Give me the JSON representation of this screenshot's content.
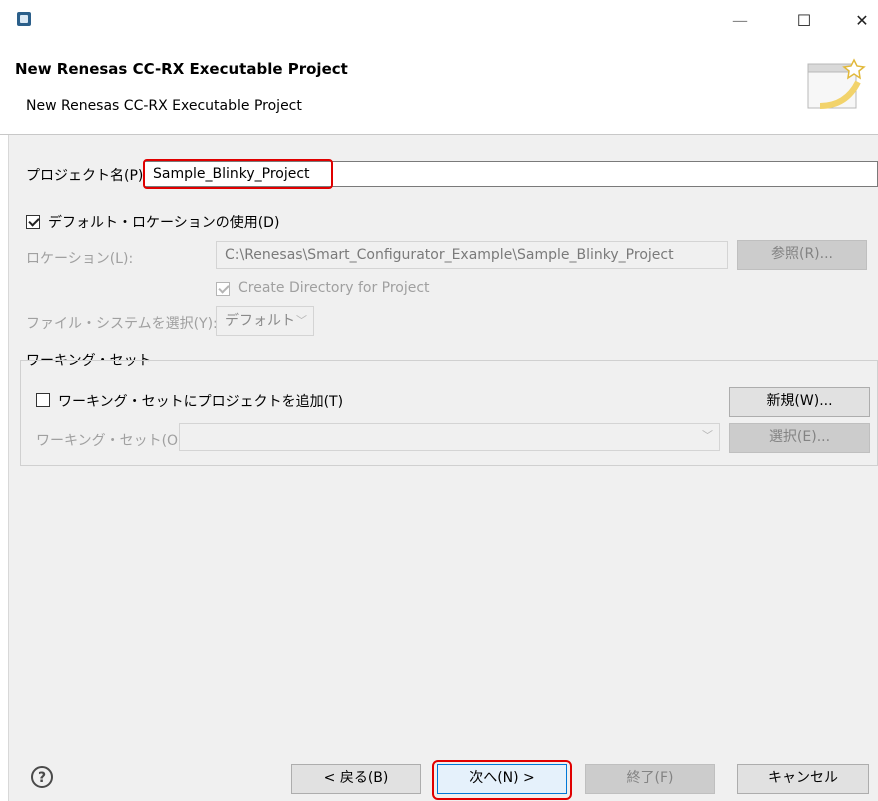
{
  "window": {
    "title_icon": "eclipse-app-icon",
    "controls": {
      "minimize": "—",
      "maximize": "☐",
      "close": "✕"
    }
  },
  "header": {
    "title": "New Renesas CC-RX Executable Project",
    "description": "New Renesas CC-RX Executable Project",
    "wizard_icon": "wizard-banner-icon"
  },
  "form": {
    "project_name_label": "プロジェクト名(P):",
    "project_name_value": "Sample_Blinky_Project",
    "use_default_location_label": "デフォルト・ロケーションの使用(D)",
    "use_default_location_checked": true,
    "location_label": "ロケーション(L):",
    "location_value": "C:\\Renesas\\Smart_Configurator_Example\\Sample_Blinky_Project",
    "browse_label": "参照(R)...",
    "create_directory_label": "Create Directory for Project",
    "create_directory_checked": true,
    "file_system_label": "ファイル・システムを選択(Y):",
    "file_system_value": "デフォルト"
  },
  "working_set": {
    "group_label": "ワーキング・セット",
    "add_label": "ワーキング・セットにプロジェクトを追加(T)",
    "add_checked": false,
    "new_button": "新規(W)...",
    "sets_label": "ワーキング・セット(O):",
    "select_button": "選択(E)..."
  },
  "footer": {
    "help_icon": "help-icon",
    "help_glyph": "?",
    "back_button": "< 戻る(B)",
    "next_button": "次へ(N) >",
    "finish_button": "終了(F)",
    "cancel_button": "キャンセル"
  },
  "colors": {
    "highlight": "#e00000",
    "dialog_bg": "#f0f0f0",
    "button_bg": "#e1e1e1",
    "disabled_text": "#a0a0a0"
  }
}
